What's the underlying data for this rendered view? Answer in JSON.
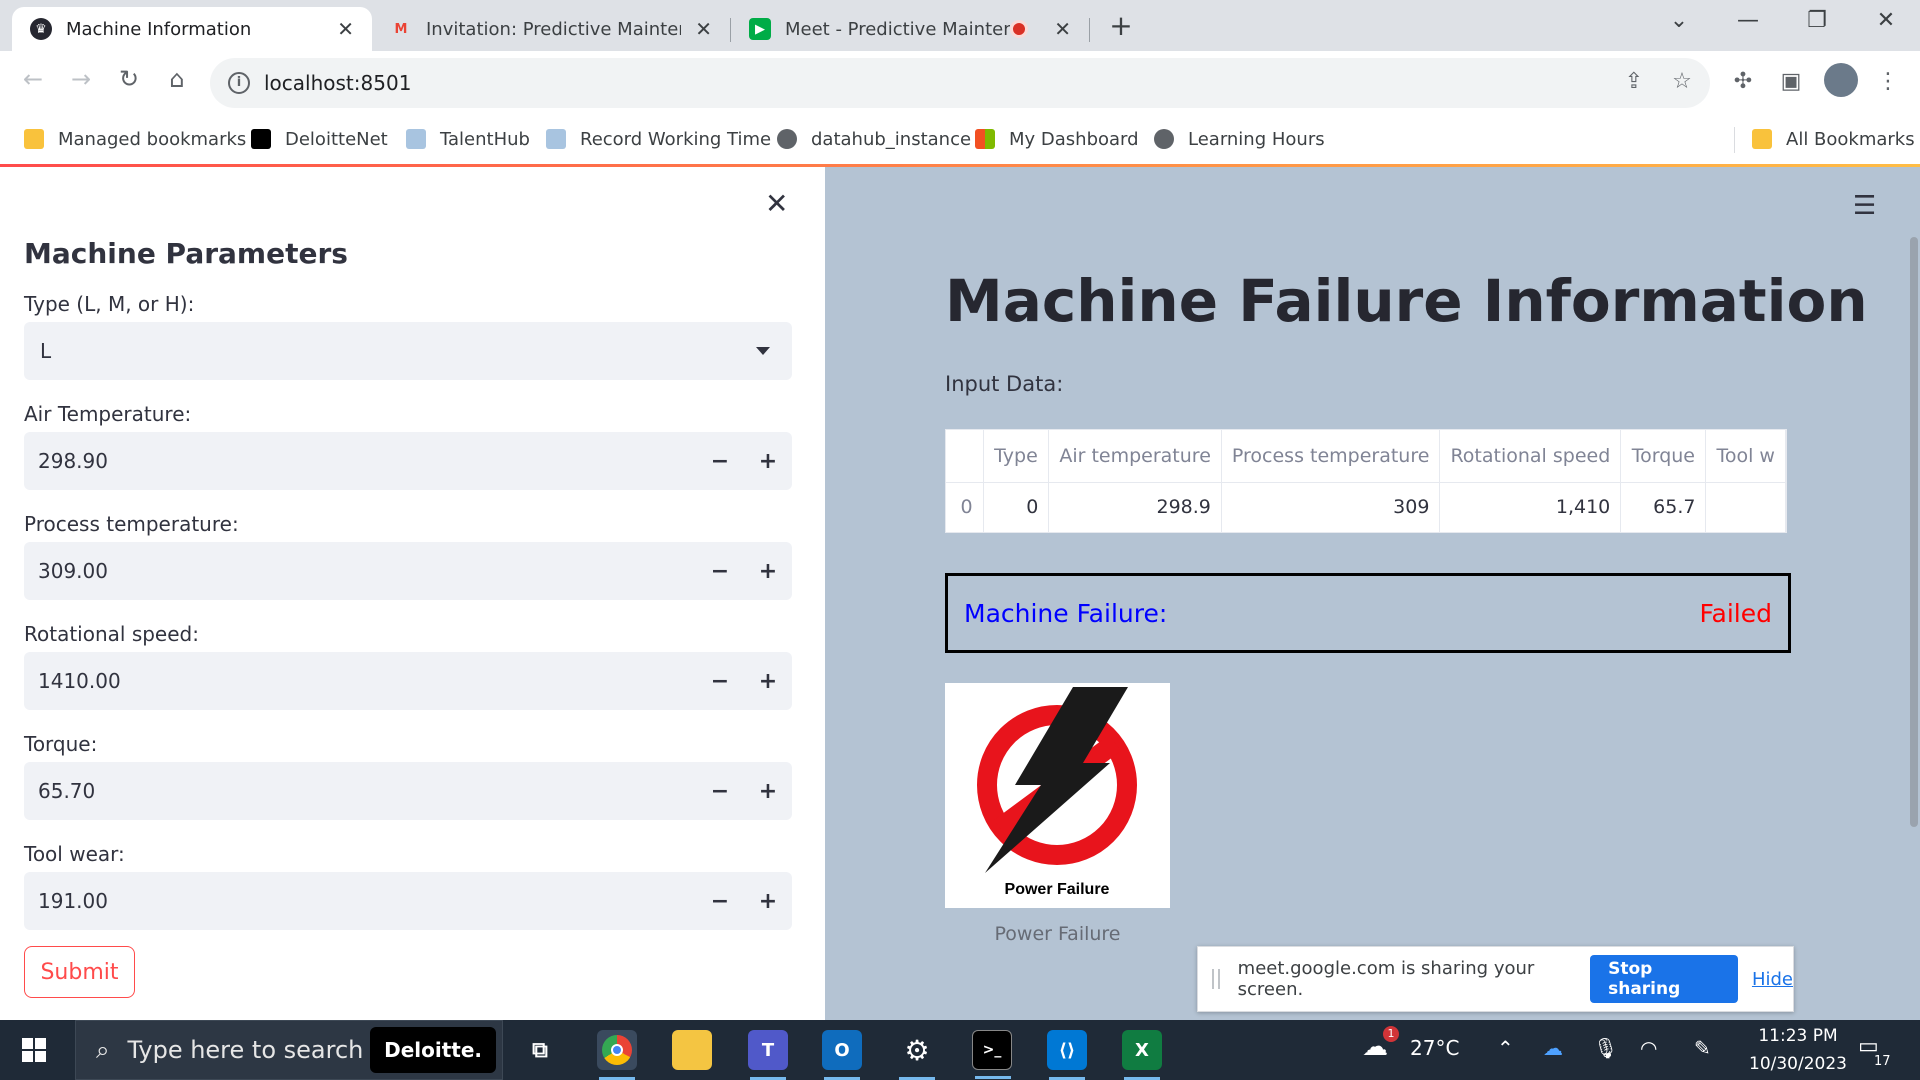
{
  "browser": {
    "tabs": [
      {
        "title": "Machine Information"
      },
      {
        "title": "Invitation: Predictive Maintenance"
      },
      {
        "title": "Meet - Predictive Maintenance"
      }
    ],
    "url": "localhost:8501",
    "bookmarks": [
      "Managed bookmarks",
      "DeloitteNet",
      "TalentHub",
      "Record Working Time",
      "datahub_instance",
      "My Dashboard",
      "Learning Hours"
    ],
    "all_bookmarks": "All Bookmarks"
  },
  "sidebar": {
    "title": "Machine Parameters",
    "type_label": "Type (L, M, or H):",
    "type_value": "L",
    "fields": [
      {
        "label": "Air Temperature:",
        "value": "298.90"
      },
      {
        "label": "Process temperature:",
        "value": "309.00"
      },
      {
        "label": "Rotational speed:",
        "value": "1410.00"
      },
      {
        "label": "Torque:",
        "value": "65.70"
      },
      {
        "label": "Tool wear:",
        "value": "191.00"
      }
    ],
    "minus": "−",
    "plus": "+",
    "submit": "Submit"
  },
  "main": {
    "title": "Machine Failure Information",
    "input_label": "Input Data:",
    "table": {
      "headers": [
        "",
        "Type",
        "Air temperature",
        "Process temperature",
        "Rotational speed",
        "Torque",
        "Tool w"
      ],
      "row": [
        "0",
        "0",
        "298.9",
        "309",
        "1,410",
        "65.7",
        ""
      ]
    },
    "failure_key": "Machine Failure:",
    "failure_value": "Failed",
    "image_text": "Power Failure",
    "image_caption": "Power Failure"
  },
  "share_bar": {
    "message": "meet.google.com is sharing your screen.",
    "stop": "Stop sharing",
    "hide": "Hide"
  },
  "taskbar": {
    "search_placeholder": "Type here to search",
    "deloitte": "Deloitte.",
    "weather": "27°C",
    "time": "11:23 PM",
    "date": "10/30/2023",
    "notifications": "17",
    "weather_badge": "1"
  },
  "colors": {
    "accent": "#ff4b4b",
    "main_bg": "#b4c3d3",
    "failure_label": "#0000ff",
    "failure_value": "#ff0000",
    "share_button": "#1a73e8"
  }
}
